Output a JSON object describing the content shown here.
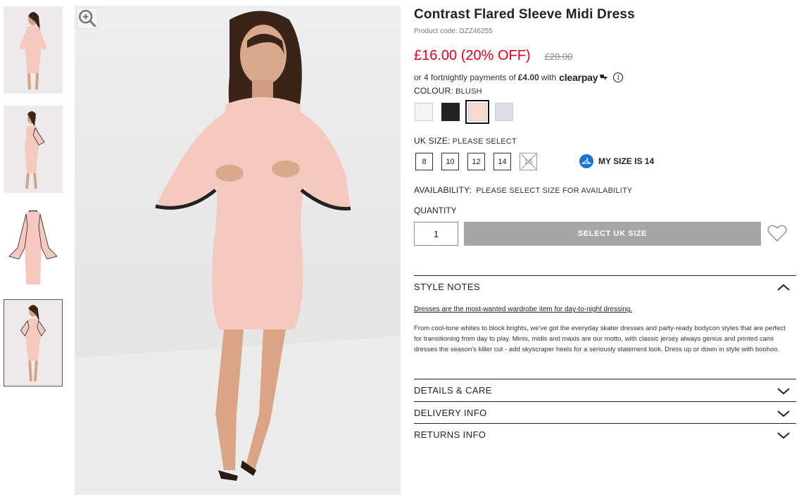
{
  "product": {
    "title": "Contrast Flared Sleeve Midi Dress",
    "code": "Product code: DZZ46255",
    "price_now": "£16.00 (20% OFF)",
    "price_was": "£20.00"
  },
  "clearpay": {
    "prefix": "or 4 fortnightly payments of",
    "amount": "£4.00",
    "suffix": "with",
    "logo": "clearpay",
    "info_icon": "info-icon"
  },
  "colour": {
    "label": "COLOUR:",
    "value": "BLUSH",
    "swatches": [
      {
        "name": "white",
        "color": "#f5f5f5",
        "selected": false
      },
      {
        "name": "black",
        "color": "#222222",
        "selected": false
      },
      {
        "name": "blush",
        "color": "#f9d8d4",
        "selected": true
      },
      {
        "name": "lilac",
        "color": "#dcdde9",
        "selected": false
      }
    ]
  },
  "size": {
    "label": "UK SIZE:",
    "value": "PLEASE SELECT",
    "options": [
      {
        "label": "8",
        "available": true
      },
      {
        "label": "10",
        "available": true
      },
      {
        "label": "12",
        "available": true
      },
      {
        "label": "14",
        "available": true
      },
      {
        "label": "16",
        "available": false
      }
    ],
    "my_size": "MY SIZE IS 14"
  },
  "availability": {
    "label": "AVAILABILITY:",
    "value": "PLEASE SELECT SIZE FOR AVAILABILITY"
  },
  "quantity": {
    "label": "QUANTITY",
    "value": "1"
  },
  "add_button": "SELECT UK SIZE",
  "accordions": {
    "style_notes": {
      "title": "STYLE NOTES",
      "link": "Dresses are the most-wanted wardrobe item for day-to-night dressing.",
      "body": "From cool-tone whites to block brights, we've got the everyday skater dresses and party-ready bodycon styles that are perfect for transitioning from day to play. Minis, midis and maxis are our motto, with classic jersey always genius and printed cami dresses the season's killer cut - add skyscraper heels for a seriously statement look. Dress up or down in style with boohoo."
    },
    "details": {
      "title": "DETAILS & CARE"
    },
    "delivery": {
      "title": "DELIVERY INFO"
    },
    "returns": {
      "title": "RETURNS INFO"
    }
  },
  "colors": {
    "sale_red": "#e0001b",
    "button_grey": "#a6a6a6",
    "mysize_blue": "#1a73d9",
    "dress_blush": "#f6c9bf"
  }
}
